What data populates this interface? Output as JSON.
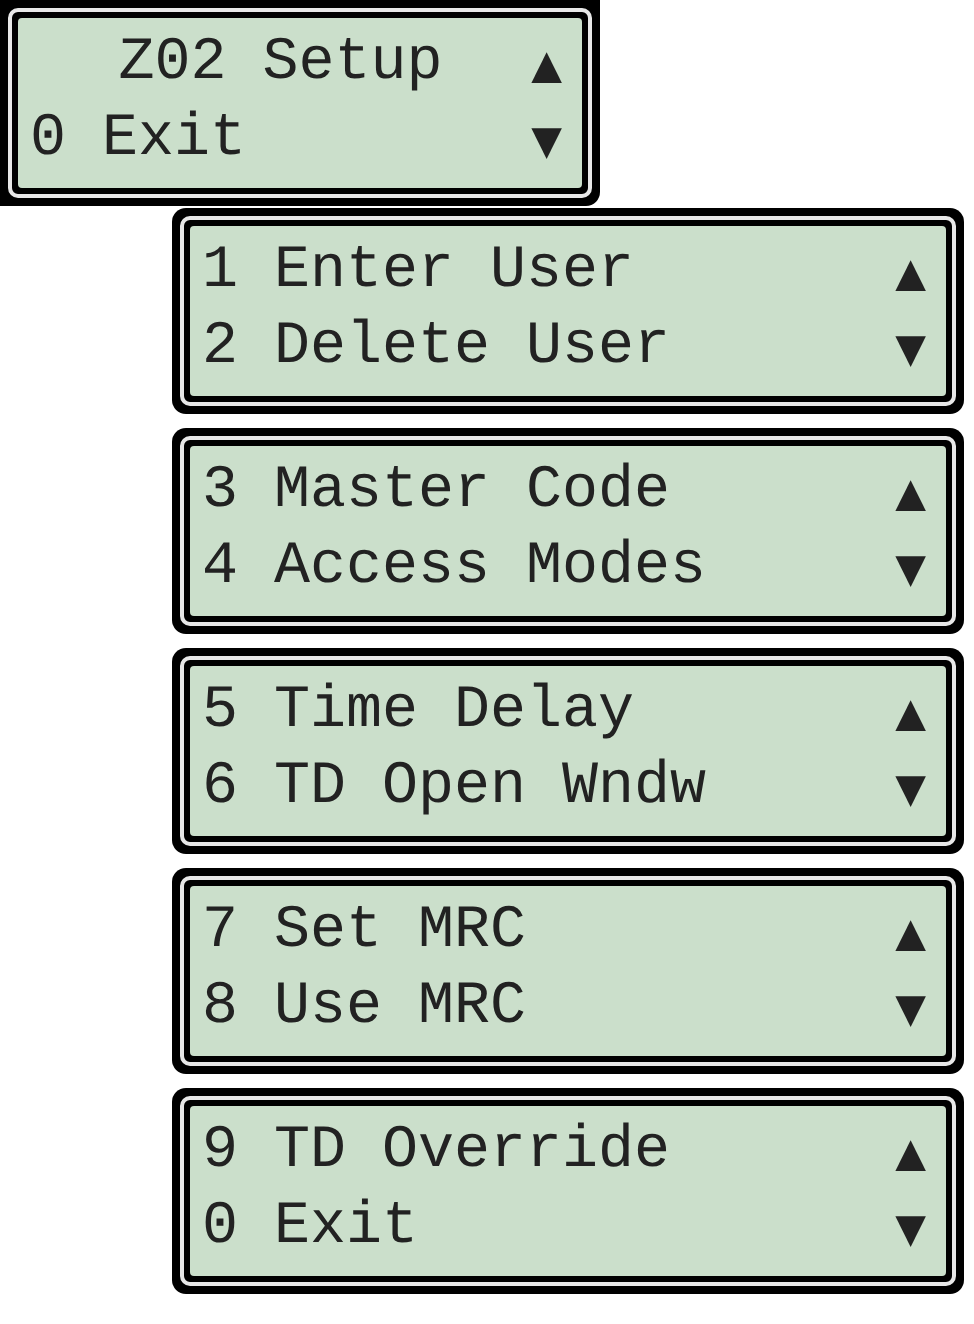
{
  "screens": [
    {
      "lines": [
        {
          "kind": "title",
          "text": "Z02 Setup",
          "arrow": "▲"
        },
        {
          "kind": "item",
          "text": "0 Exit",
          "arrow": "▼"
        }
      ]
    },
    {
      "lines": [
        {
          "kind": "item",
          "text": "1 Enter User",
          "arrow": "▲"
        },
        {
          "kind": "item",
          "text": "2 Delete User",
          "arrow": "▼"
        }
      ]
    },
    {
      "lines": [
        {
          "kind": "item",
          "text": "3 Master Code",
          "arrow": "▲"
        },
        {
          "kind": "item",
          "text": "4 Access Modes",
          "arrow": "▼"
        }
      ]
    },
    {
      "lines": [
        {
          "kind": "item",
          "text": "5 Time Delay",
          "arrow": "▲"
        },
        {
          "kind": "item",
          "text": "6 TD Open Wndw",
          "arrow": "▼"
        }
      ]
    },
    {
      "lines": [
        {
          "kind": "item",
          "text": "7 Set MRC",
          "arrow": "▲"
        },
        {
          "kind": "item",
          "text": "8 Use MRC",
          "arrow": "▼"
        }
      ]
    },
    {
      "lines": [
        {
          "kind": "item",
          "text": "9 TD Override",
          "arrow": "▲"
        },
        {
          "kind": "item",
          "text": "0 Exit",
          "arrow": "▼"
        }
      ]
    }
  ]
}
